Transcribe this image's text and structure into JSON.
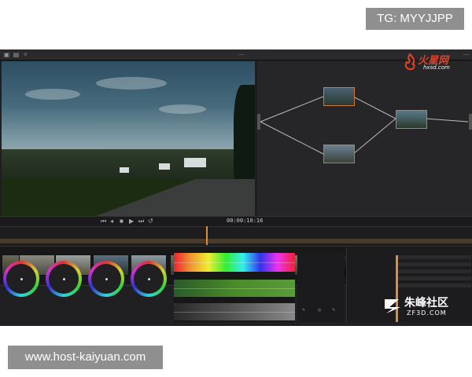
{
  "watermarks": {
    "top": "TG: MYYJJPP",
    "bottom": "www.host-kaiyuan.com"
  },
  "colors": {
    "app_bg": "#1f1f21",
    "accent": "#e08a3c",
    "logo_red": "#e2442a"
  },
  "logos": {
    "huoxing_main": "火星网",
    "huoxing_sub": "hxsd.com",
    "zf3d_main": "朱峰社区",
    "zf3d_sub": "ZF3D.COM"
  },
  "viewer": {
    "timecode": "00:00:10:16"
  },
  "transport": {
    "icons": [
      "skip-start-icon",
      "step-back-icon",
      "play-reverse-icon",
      "stop-icon",
      "play-icon",
      "step-forward-icon",
      "skip-end-icon",
      "loop-icon"
    ]
  }
}
